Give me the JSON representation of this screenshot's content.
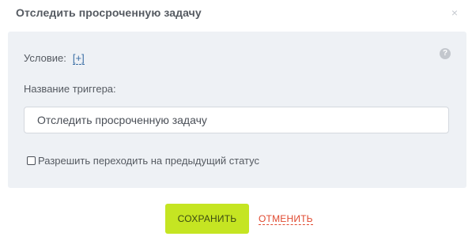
{
  "dialog": {
    "title": "Отследить просроченную задачу",
    "close_symbol": "×"
  },
  "panel": {
    "help_symbol": "?",
    "condition_label": "Условие:",
    "condition_add": "[+]",
    "trigger_label": "Название триггера:",
    "trigger_value": "Отследить просроченную задачу",
    "checkbox_label": "Разрешить переходить на предыдущий статус",
    "checkbox_checked": false
  },
  "actions": {
    "save_label": "СОХРАНИТЬ",
    "cancel_label": "ОТМЕНИТЬ"
  },
  "colors": {
    "panel_bg": "#eef1f5",
    "save_bg": "#c5e522",
    "cancel_text": "#e0492f",
    "link": "#3a6ea5"
  },
  "icons": {
    "close": "close-icon",
    "help": "help-icon"
  }
}
